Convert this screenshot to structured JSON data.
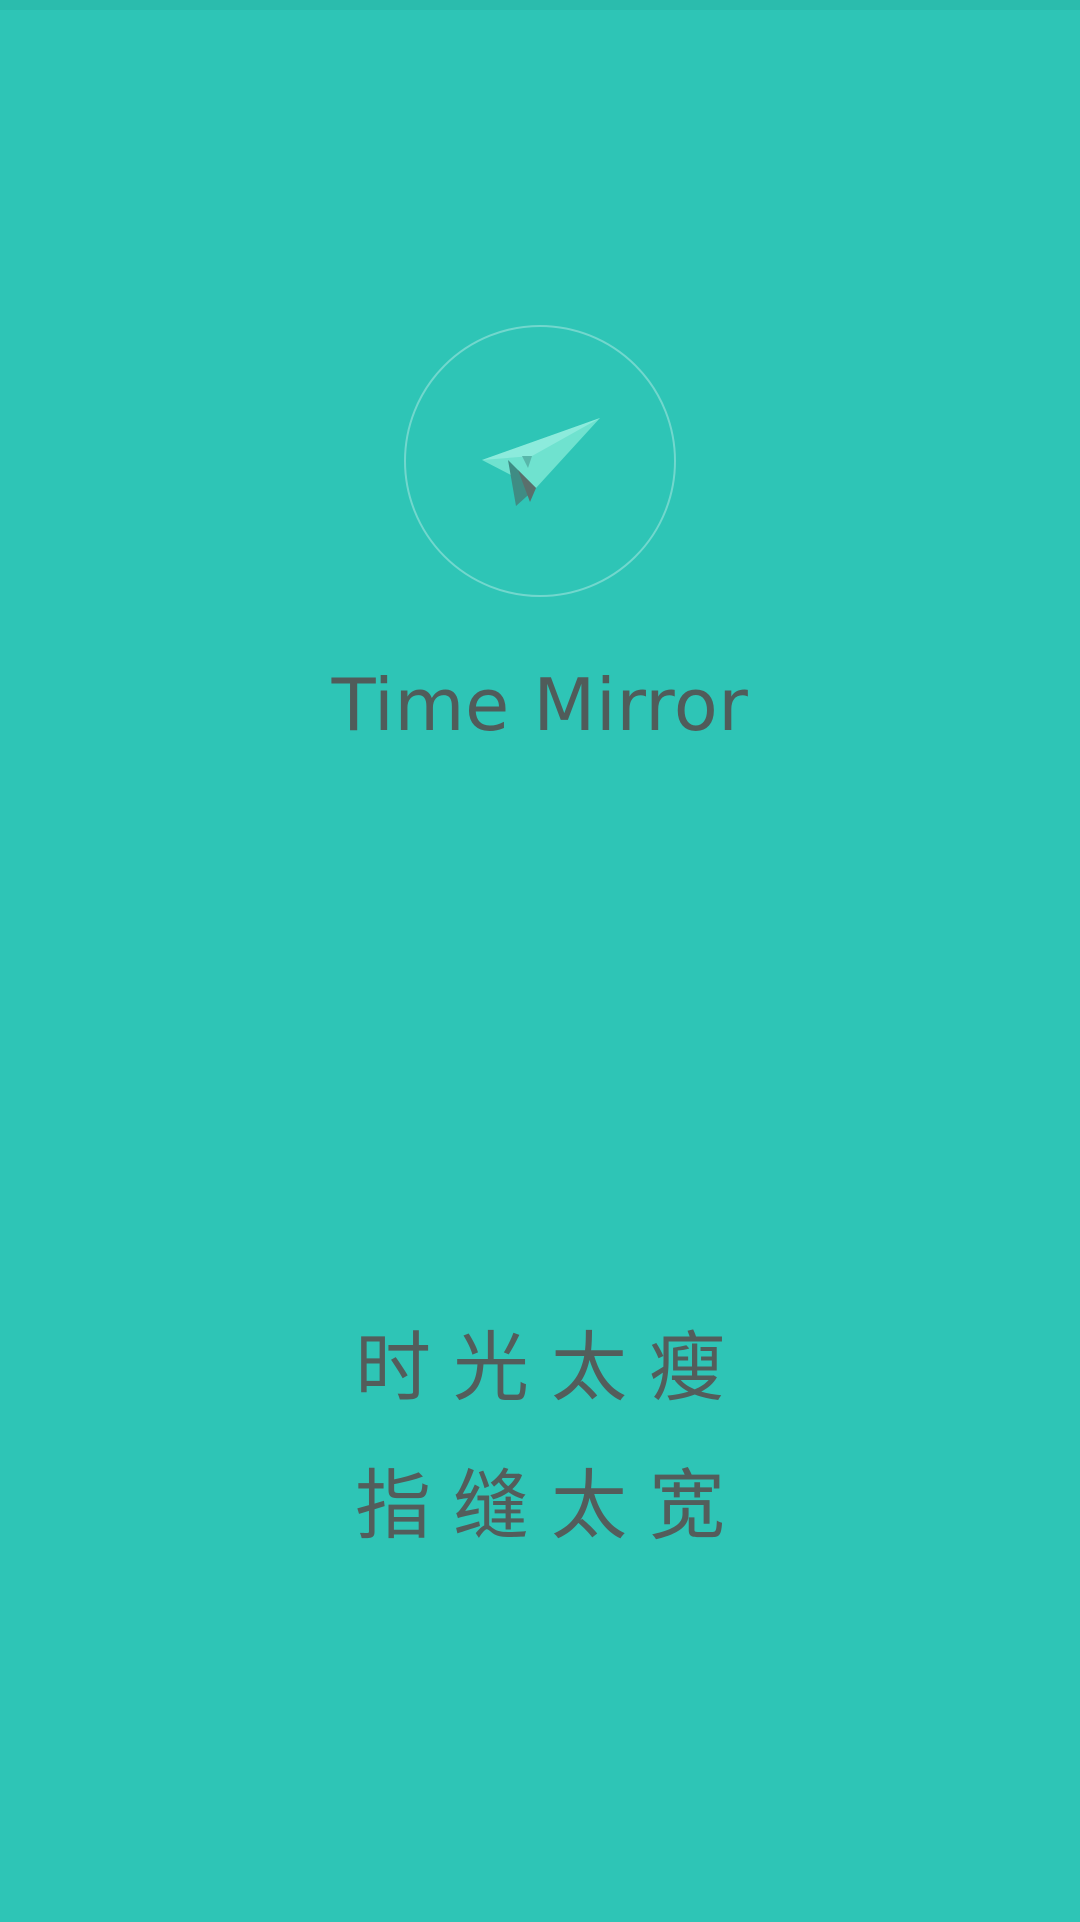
{
  "app": {
    "title": "Time Mirror",
    "logo_icon": "paper-plane-icon",
    "background_color": "#2ec5b6",
    "text_color": "#535d5b"
  },
  "slogan": {
    "line1": "时光太瘦",
    "line2": "指缝太宽"
  }
}
